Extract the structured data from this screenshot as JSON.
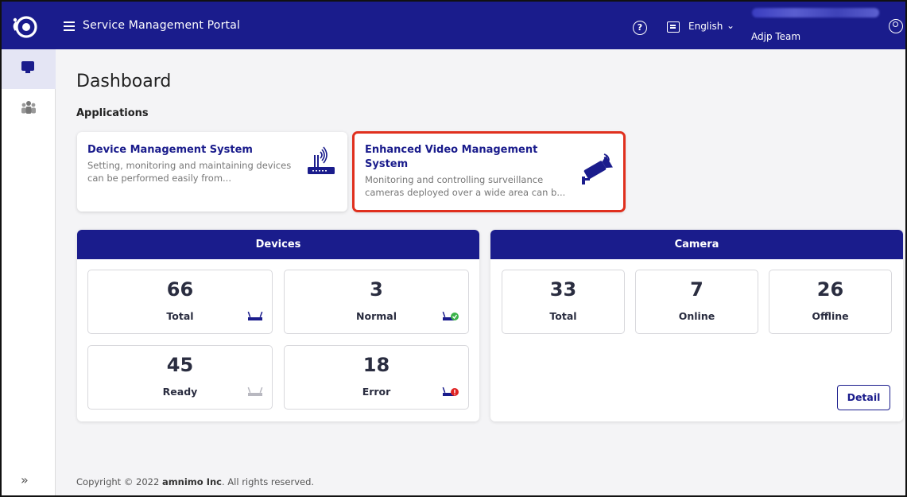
{
  "header": {
    "title": "Service Management Portal",
    "language": "English",
    "user_team": "Adjp Team"
  },
  "main": {
    "page_title": "Dashboard",
    "applications_label": "Applications",
    "apps": [
      {
        "name": "Device Management System",
        "description": "Setting, monitoring and maintaining devices can be performed easily from..."
      },
      {
        "name": "Enhanced Video Management System",
        "description": "Monitoring and controlling surveillance cameras deployed over a wide area can b..."
      }
    ],
    "devices": {
      "title": "Devices",
      "stats": [
        {
          "value": "66",
          "label": "Total"
        },
        {
          "value": "3",
          "label": "Normal"
        },
        {
          "value": "45",
          "label": "Ready"
        },
        {
          "value": "18",
          "label": "Error"
        }
      ]
    },
    "camera": {
      "title": "Camera",
      "stats": [
        {
          "value": "33",
          "label": "Total"
        },
        {
          "value": "7",
          "label": "Online"
        },
        {
          "value": "26",
          "label": "Offline"
        }
      ],
      "detail_label": "Detail"
    }
  },
  "footer": {
    "prefix": "Copyright © 2022 ",
    "company": "amnimo Inc",
    "suffix": ". All rights reserved."
  },
  "colors": {
    "brand": "#1a1c8c",
    "highlight": "#e0301e",
    "ok": "#3cb44a",
    "error": "#e02424"
  }
}
